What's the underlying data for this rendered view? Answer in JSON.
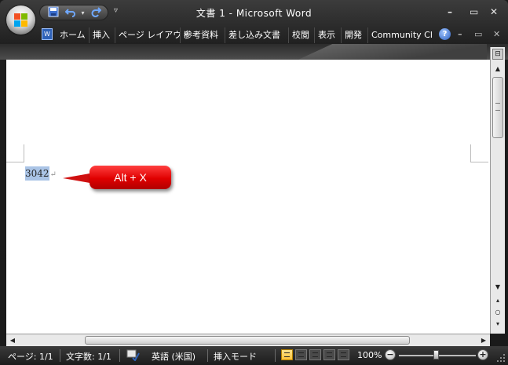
{
  "window": {
    "title": "文書 1 - Microsoft Word"
  },
  "quick_access": {
    "icons": [
      "save-icon",
      "undo-icon",
      "redo-icon"
    ],
    "more": "▿"
  },
  "window_controls": {
    "minimize": "–",
    "maximize": "▭",
    "close": "✕"
  },
  "ribbon": {
    "tabs": [
      "ホーム",
      "挿入",
      "ページ レイアウト",
      "参考資料",
      "差し込み文書",
      "校閲",
      "表示",
      "開発",
      "Community Cl"
    ],
    "help": "?",
    "doc_controls": {
      "minimize": "–",
      "restore": "▭",
      "close": "✕"
    }
  },
  "document": {
    "selected_text": "3042",
    "paragraph_mark": "↵",
    "callout_text": "Alt + X"
  },
  "status_bar": {
    "page": "ページ: 1/1",
    "word_count": "文字数: 1/1",
    "language": "英語 (米国)",
    "insert_mode": "挿入モード",
    "zoom_level": "100%",
    "zoom_minus": "−",
    "zoom_plus": "+",
    "zoom_value": 100
  },
  "colors": {
    "selection": "#aac4e6",
    "callout": "#e00000"
  }
}
